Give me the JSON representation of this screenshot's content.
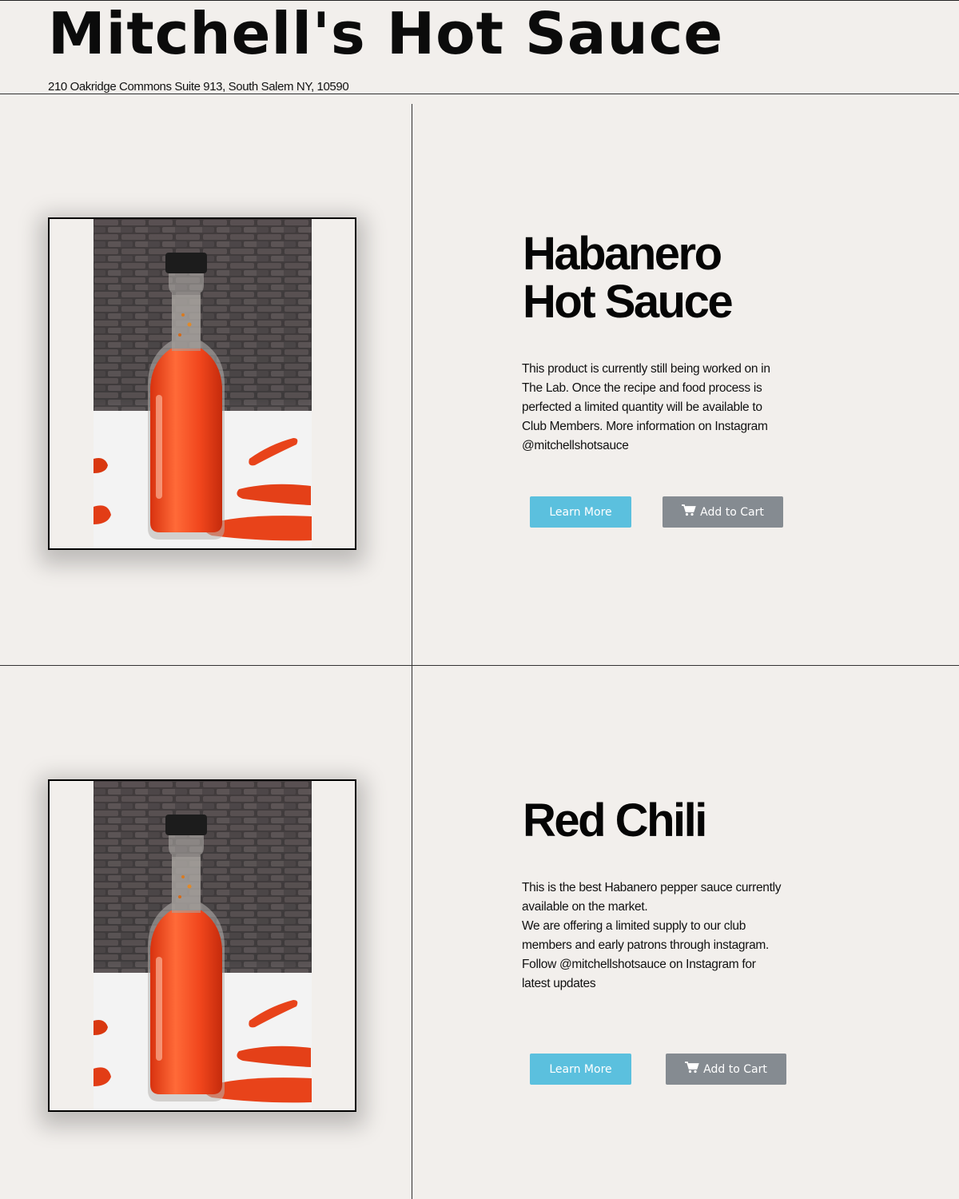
{
  "site": {
    "title": "Mitchell's Hot Sauce",
    "address": "210 Oakridge Commons Suite 913, South Salem NY, 10590"
  },
  "products": [
    {
      "title_lines": [
        "Habanero",
        "Hot Sauce"
      ],
      "description_lines": [
        "This product is currently still being worked on in",
        "The Lab. Once the recipe and food process is",
        "perfected a limited quantity will be available to",
        "Club Members. More information on Instagram",
        "@mitchellshotsauce"
      ],
      "learn_more_label": "Learn More",
      "add_to_cart_label": "Add to Cart",
      "image_icon": "hot-sauce-bottle-photo"
    },
    {
      "title_lines": [
        "Red Chili"
      ],
      "description_lines": [
        "This is the best Habanero pepper sauce currently",
        "available on the market.",
        "We are offering a limited supply to our club",
        "members and early patrons through instagram.",
        "Follow @mitchellshotsauce on Instagram for",
        "latest updates"
      ],
      "learn_more_label": "Learn More",
      "add_to_cart_label": "Add to Cart",
      "image_icon": "hot-sauce-bottle-photo"
    }
  ],
  "colors": {
    "background": "#f2efec",
    "learn_more_button": "#5bc0de",
    "add_to_cart_button": "#858b91",
    "sauce": "#f0451c",
    "pepper": "#e8431a"
  },
  "icons": {
    "cart": "shopping-cart-icon"
  }
}
